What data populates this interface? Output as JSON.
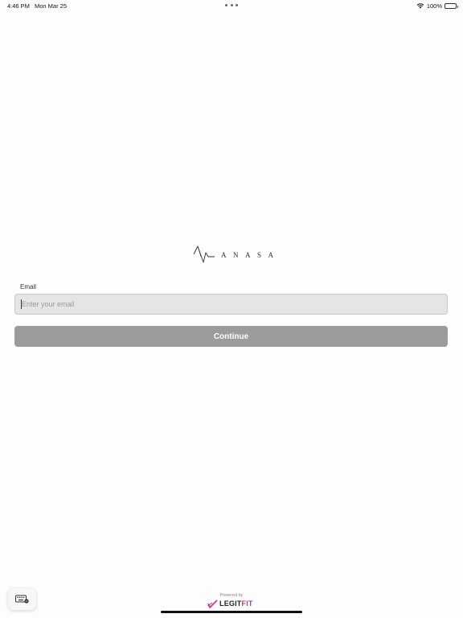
{
  "status_bar": {
    "time": "4:46 PM",
    "date": "Mon Mar 25",
    "battery": "100%",
    "battery_level": 1.0
  },
  "brand": {
    "name": "ANASA",
    "mark_icon": "anasa-pulse-logo-icon"
  },
  "form": {
    "email_label": "Email",
    "email_placeholder": "Enter your email",
    "email_value": "",
    "continue_label": "Continue"
  },
  "footer": {
    "powered_by": "Powered by",
    "logo_left": "LEGIT",
    "logo_right": "FIT",
    "logo_accent_color": "#d12f8c"
  },
  "colors": {
    "button_bg": "#9a9d9b",
    "input_bg": "#e5e5e5",
    "page_bg": "#fdfdfd"
  }
}
